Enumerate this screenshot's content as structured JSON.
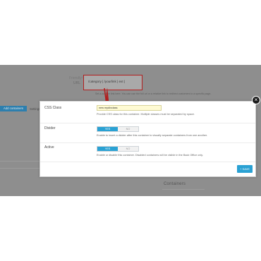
{
  "background": {
    "url_field_label": "Friendly URL",
    "row_label": "URL",
    "url_value": "/category | /yourlink | ext |",
    "hint": "Set a custom link here. You can use the full url or a relative link to redirect customers to a specific page.",
    "add_button": "Add containers",
    "tab_label": "Settings",
    "section_label": "Containers"
  },
  "modal": {
    "close_glyph": "×",
    "css_class": {
      "label": "CSS Class",
      "value": "new mydivclass",
      "help": "Provide CSS class for this container. Multiple classes must be separated by space."
    },
    "divider": {
      "label": "Divider",
      "yes": "YES",
      "no": "NO",
      "help": "Enable to insert a divider after this container to visually separate containers from one another."
    },
    "active": {
      "label": "Active",
      "yes": "YES",
      "no": "NO",
      "help": "Enable or disable this container. Disabled containers will be visible in the Back Office only."
    },
    "save_label": "SAVE",
    "save_icon": "plus-icon"
  },
  "colors": {
    "accent": "#2aa1d3",
    "highlight_border": "#b21f1f",
    "backdrop": "#8e8e8e"
  }
}
